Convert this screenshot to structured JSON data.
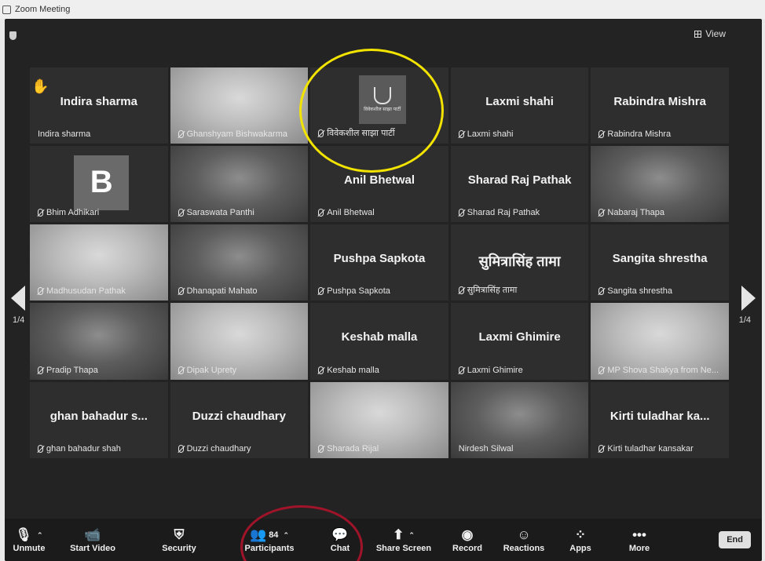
{
  "window": {
    "title": "Zoom Meeting"
  },
  "header": {
    "view_label": "View"
  },
  "pagination": {
    "left": "1/4",
    "right": "1/4"
  },
  "tiles": [
    {
      "name": "Indira sharma",
      "label": "Indira sharma",
      "kind": "name",
      "muted": false
    },
    {
      "name": "",
      "label": "Ghanshyam Bishwakarma",
      "kind": "video",
      "muted": true
    },
    {
      "name": "",
      "label": "विवेकशील साझा पार्टी",
      "kind": "logo",
      "logo_text": "विवेकशील साझा पार्टी",
      "muted": true
    },
    {
      "name": "Laxmi shahi",
      "label": "Laxmi shahi",
      "kind": "name",
      "muted": true
    },
    {
      "name": "Rabindra Mishra",
      "label": "Rabindra Mishra",
      "kind": "name",
      "muted": true
    },
    {
      "name": "B",
      "label": "Bhim Adhikari",
      "kind": "avatar",
      "muted": true
    },
    {
      "name": "",
      "label": "Saraswata Panthi",
      "kind": "video",
      "muted": true
    },
    {
      "name": "Anil Bhetwal",
      "label": "Anil Bhetwal",
      "kind": "name",
      "muted": true
    },
    {
      "name": "Sharad Raj Pathak",
      "label": "Sharad Raj Pathak",
      "kind": "name",
      "muted": true
    },
    {
      "name": "",
      "label": "Nabaraj Thapa",
      "kind": "video",
      "muted": true
    },
    {
      "name": "",
      "label": "Madhusudan Pathak",
      "kind": "video",
      "muted": true
    },
    {
      "name": "",
      "label": "Dhanapati Mahato",
      "kind": "video",
      "muted": true
    },
    {
      "name": "Pushpa Sapkota",
      "label": "Pushpa Sapkota",
      "kind": "name",
      "muted": true
    },
    {
      "name": "सुमित्रासिंह तामा",
      "label": "सुमित्रासिंह तामा",
      "kind": "name-deva",
      "muted": true
    },
    {
      "name": "Sangita shrestha",
      "label": "Sangita shrestha",
      "kind": "name",
      "muted": true
    },
    {
      "name": "",
      "label": "Pradip Thapa",
      "kind": "video",
      "muted": true
    },
    {
      "name": "",
      "label": "Dipak Uprety",
      "kind": "video",
      "muted": true
    },
    {
      "name": "Keshab malla",
      "label": "Keshab malla",
      "kind": "name",
      "muted": true
    },
    {
      "name": "Laxmi Ghimire",
      "label": "Laxmi Ghimire",
      "kind": "name",
      "muted": true
    },
    {
      "name": "",
      "label": "MP Shova Shakya from Ne...",
      "kind": "video",
      "muted": true
    },
    {
      "name": "ghan bahadur s...",
      "label": "ghan bahadur shah",
      "kind": "name",
      "muted": true
    },
    {
      "name": "Duzzi chaudhary",
      "label": "Duzzi chaudhary",
      "kind": "name",
      "muted": true
    },
    {
      "name": "",
      "label": "Sharada Rijal",
      "kind": "video",
      "muted": true
    },
    {
      "name": "",
      "label": "Nirdesh Silwal",
      "kind": "video",
      "muted": false
    },
    {
      "name": "Kirti tuladhar ka...",
      "label": "Kirti tuladhar kansakar",
      "kind": "name",
      "muted": true
    }
  ],
  "toolbar": {
    "unmute": "Unmute",
    "start_video": "Start Video",
    "security": "Security",
    "participants": "Participants",
    "participants_count": "84",
    "chat": "Chat",
    "share_screen": "Share Screen",
    "record": "Record",
    "reactions": "Reactions",
    "apps": "Apps",
    "more": "More",
    "end": "End"
  }
}
